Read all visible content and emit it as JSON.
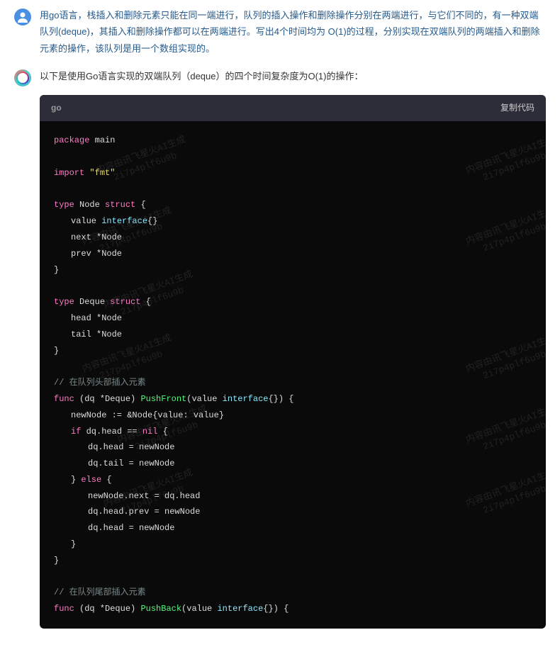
{
  "user_message": "用go语言，栈插入和删除元素只能在同一端进行，队列的插入操作和删除操作分别在两端进行，与它们不同的，有一种双端队列(deque)，其插入和删除操作都可以在两端进行。写出4个时间均为 O(1)的过程，分别实现在双端队列的两端插入和删除元素的操作，该队列是用一个数组实现的。",
  "bot_intro": "以下是使用Go语言实现的双端队列（deque）的四个时间复杂度为O(1)的操作：",
  "code": {
    "lang": "go",
    "copy_label": "复制代码",
    "lines": {
      "l1_kw": "package",
      "l1_id": " main",
      "l3_kw": "import",
      "l3_str": " \"fmt\"",
      "l5_kw": "type",
      "l5_id": " Node ",
      "l5_kw2": "struct",
      "l5_b": " {",
      "l6": "value ",
      "l6_ty": "interface",
      "l6_b": "{}",
      "l7": "next  *Node",
      "l8": "prev  *Node",
      "l9": "}",
      "l11_kw": "type",
      "l11_id": " Deque ",
      "l11_kw2": "struct",
      "l11_b": " {",
      "l12": "head *Node",
      "l13": "tail *Node",
      "l14": "}",
      "l16_cm": "// 在队列头部插入元素",
      "l17_kw": "func",
      "l17_a": " (dq *Deque) ",
      "l17_fn": "PushFront",
      "l17_b": "(value ",
      "l17_ty": "interface",
      "l17_c": "{}) {",
      "l18": "newNode := &Node{value: value}",
      "l19_kw": "if",
      "l19_a": " dq.head == ",
      "l19_kw2": "nil",
      "l19_b": " {",
      "l20": "dq.head = newNode",
      "l21": "dq.tail = newNode",
      "l22_a": "} ",
      "l22_kw": "else",
      "l22_b": " {",
      "l23": "newNode.next = dq.head",
      "l24": "dq.head.prev = newNode",
      "l25": "dq.head = newNode",
      "l26": "}",
      "l27": "}",
      "l29_cm": "// 在队列尾部插入元素",
      "l30_kw": "func",
      "l30_a": " (dq *Deque) ",
      "l30_fn": "PushBack",
      "l30_b": "(value ",
      "l30_ty": "interface",
      "l30_c": "{}) {"
    }
  },
  "watermark": {
    "line1": "内容由讯飞星火AI生成",
    "line2": "2i7p4plf6u9b"
  }
}
